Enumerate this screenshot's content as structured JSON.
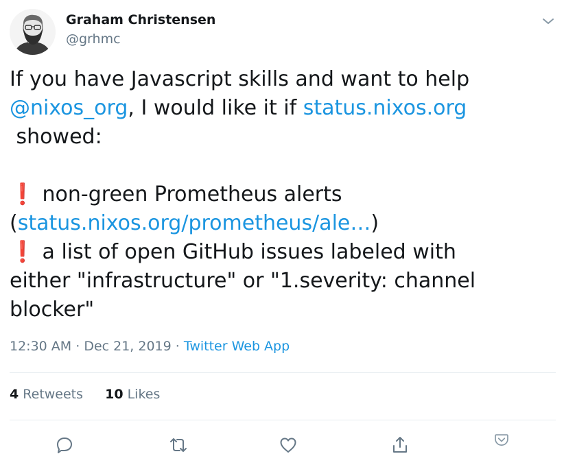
{
  "author": {
    "name": "Graham Christensen",
    "handle": "@grhmc"
  },
  "tweet": {
    "line1": "If you have Javascript skills and want to help",
    "mention": "@nixos_org",
    "line2_mid": ", I would like it if ",
    "link1": "status.nixos.org",
    "line3": " showed:",
    "bang1": "❗",
    "item1": "non-green Prometheus alerts",
    "paren_open": "(",
    "link2": "status.nixos.org/prometheus/ale…",
    "paren_close": ")",
    "bang2": "❗",
    "item2a": "a list of open GitHub issues labeled with",
    "item2b": "either \"infrastructure\" or \"1.severity: channel",
    "item2c": "blocker\""
  },
  "meta": {
    "time": "12:30 AM",
    "sep1": " · ",
    "date": "Dec 21, 2019",
    "sep2": " · ",
    "source": "Twitter Web App"
  },
  "stats": {
    "retweets_count": "4",
    "retweets_label": "Retweets",
    "likes_count": "10",
    "likes_label": "Likes"
  },
  "icons": {
    "reply": "reply-icon",
    "retweet": "retweet-icon",
    "like": "heart-icon",
    "share": "share-icon",
    "caret": "chevron-down-icon",
    "save": "pocket-icon"
  },
  "colors": {
    "link": "#1b95e0",
    "text": "#14171a",
    "muted": "#657786",
    "alert": "#dd2e44",
    "divider": "#e6ecf0"
  }
}
